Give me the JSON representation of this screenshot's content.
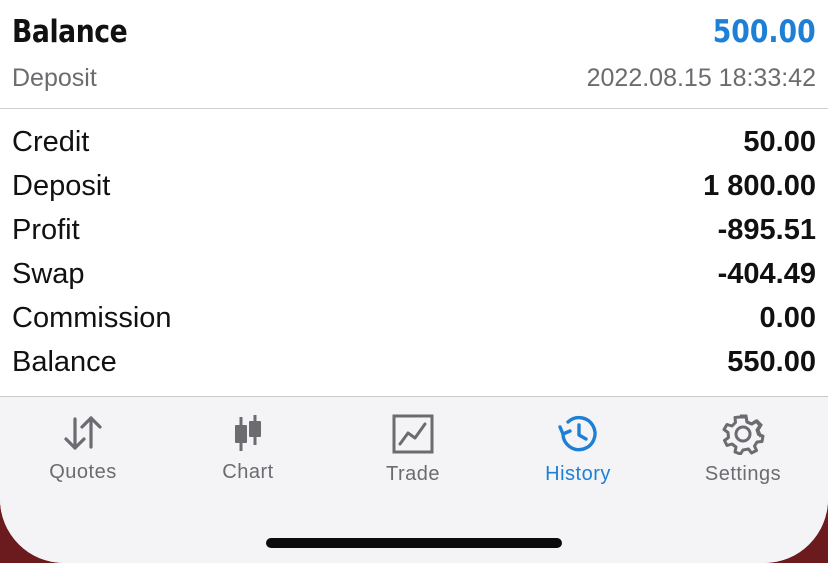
{
  "header": {
    "title": "Balance",
    "amount": "500.00",
    "subtitle": "Deposit",
    "timestamp": "2022.08.15 18:33:42"
  },
  "summary": [
    {
      "label": "Credit",
      "value": "50.00"
    },
    {
      "label": "Deposit",
      "value": "1 800.00"
    },
    {
      "label": "Profit",
      "value": "-895.51"
    },
    {
      "label": "Swap",
      "value": "-404.49"
    },
    {
      "label": "Commission",
      "value": "0.00"
    },
    {
      "label": "Balance",
      "value": "550.00"
    }
  ],
  "tabs": [
    {
      "label": "Quotes",
      "icon": "quotes-arrows-icon",
      "active": false
    },
    {
      "label": "Chart",
      "icon": "candlestick-icon",
      "active": false
    },
    {
      "label": "Trade",
      "icon": "trade-chart-icon",
      "active": false
    },
    {
      "label": "History",
      "icon": "history-clock-icon",
      "active": true
    },
    {
      "label": "Settings",
      "icon": "gear-icon",
      "active": false
    }
  ],
  "colors": {
    "accent": "#1e7fd6",
    "text": "#111111",
    "muted": "#6c6c70",
    "tab_inactive": "#6b6b70",
    "tabbar_background": "#f4f4f6"
  }
}
